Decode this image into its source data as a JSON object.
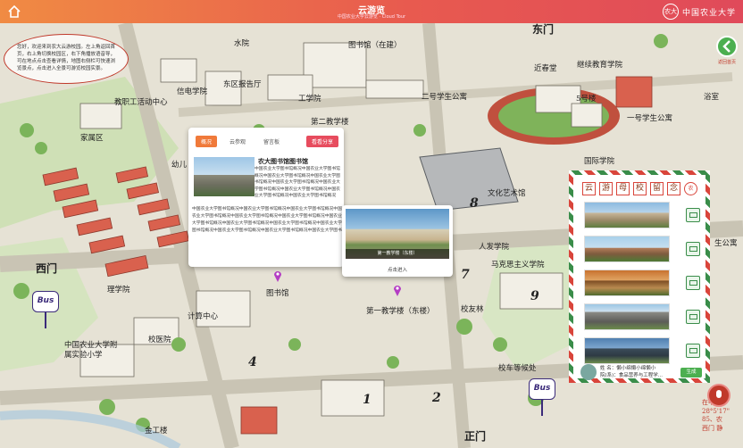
{
  "topbar": {
    "title": "云游览",
    "subtitle": "中国农业大学云游览 · Cloud Tour",
    "logo_text": "中国农业大学",
    "logo_seal": "农大"
  },
  "intro": {
    "text": "您好，欢迎来到农大云游校园。左上角返回首页，右上角切换校园区，右下角播放语音导，可在地点点击查看详情，地图右侧栏可快速浏览景点，点击进入全景可游览校园实景。"
  },
  "back_button": {
    "label": "返回首页"
  },
  "map_labels": [
    "家属区",
    "教职工活动中心",
    "水院",
    "东区报告厅",
    "信电学院",
    "幼儿",
    "工学院",
    "图书馆（在建）",
    "第二教学楼",
    "二号学生公寓",
    "东门",
    "近春堂",
    "继续教育学院",
    "浴室",
    "5号楼",
    "一号学生公寓",
    "国际学院",
    "文化艺术馆",
    "人发学院",
    "马克思主义学院",
    "校友林",
    "第一教学楼（东楼）",
    "图书馆",
    "计算中心",
    "理学院",
    "校医院",
    "西门",
    "中国农业大学附属实验小学",
    "金工楼",
    "校车等候处",
    "正门",
    "生公寓"
  ],
  "map_numbers": [
    "8",
    "7",
    "9",
    "4",
    "1",
    "2"
  ],
  "popup": {
    "tabs": [
      "概况",
      "云参观",
      "留言板"
    ],
    "share_label": "看看分享",
    "title": "农大图书馆图书馆",
    "paragraph_1": "中国农业大学图书馆概况中国农业大学图书馆概况中国农业大学图书馆概况中国农业大学图书馆概况中国农业大学图书馆概况中国农业大学图书馆概况中国农业大学图书馆概况中国农业大学图书馆概况中国农业大学图书馆概况",
    "paragraph_2": "中国农业大学图书馆概况中国农业大学图书馆概况中国农业大学图书馆概况中国农业大学图书馆概况中国农业大学图书馆概况中国农业大学图书馆概况中国农业大学图书馆概况中国农业大学图书馆概况中国农业大学图书馆概况中国农业大学图书馆概况中国农业大学图书馆概况中国农业大学图书馆概况中国农业大学图书馆概况中国农业大学图书馆概况"
  },
  "photo_card": {
    "caption": "第一教学楼（东楼）",
    "link": "点击进入"
  },
  "side_panel": {
    "chars": [
      "云",
      "游",
      "母",
      "校",
      "留",
      "念"
    ],
    "seal": "农",
    "footer_name_label": "姓 名：",
    "footer_name": "懒小绵懒小绵懒小",
    "footer_dept_label": "院(系)：",
    "footer_dept": "食品营养与工程学...",
    "footer_button": "生成"
  },
  "bus_label": "Bus",
  "corner_text": "在中国\n28°5'17\"\n85、农\n西门 静"
}
